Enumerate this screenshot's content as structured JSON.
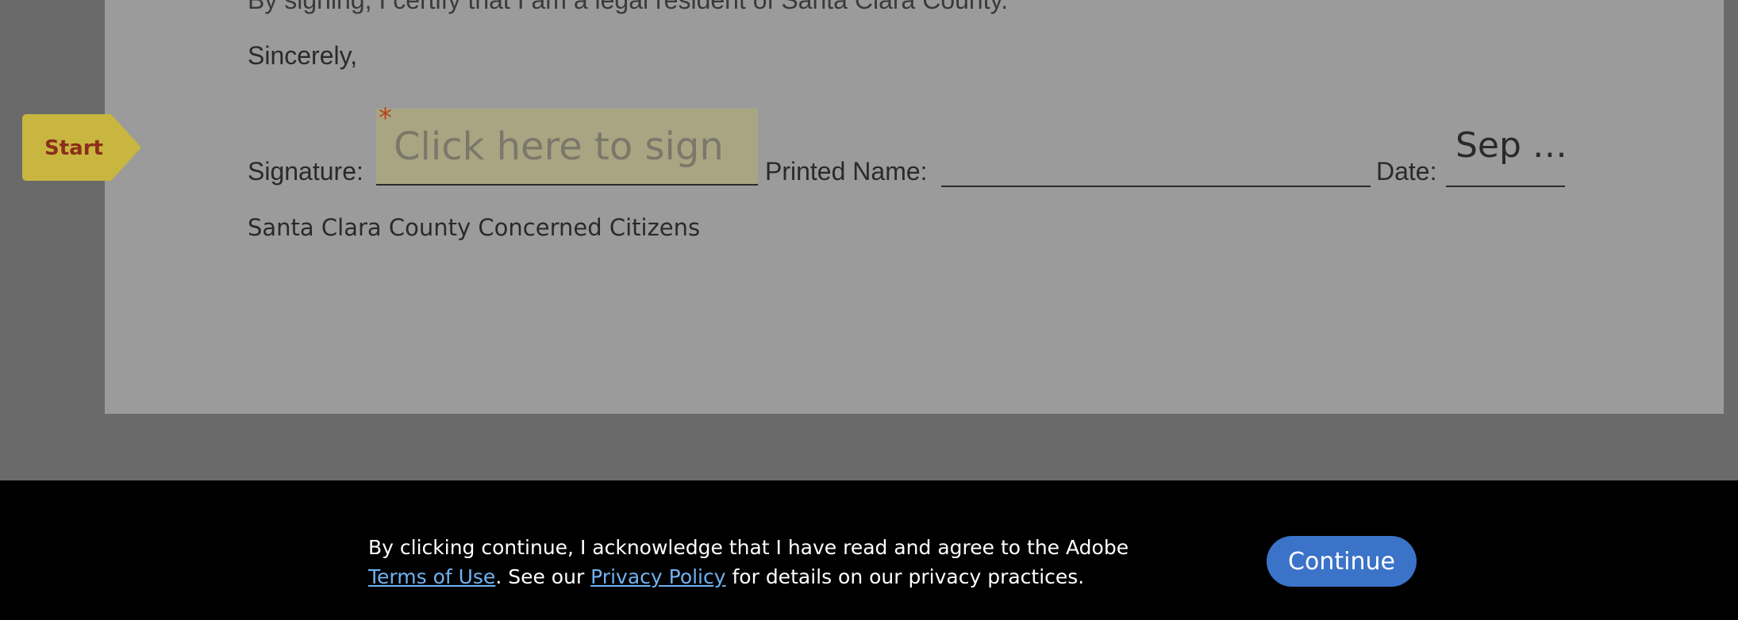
{
  "document": {
    "cut_line": "By signing, I certify that I am a legal resident of Santa Clara County.",
    "closing": "Sincerely,",
    "signature_label": "Signature:",
    "signature_placeholder": "Click here to sign",
    "required_marker": "*",
    "printed_name_label": "Printed Name:",
    "date_label": "Date:",
    "date_value": "Sep …",
    "organization": "Santa Clara County Concerned Citizens"
  },
  "start_tag": {
    "label": "Start"
  },
  "consent": {
    "text_part1": "By clicking continue, I acknowledge that I have read and agree to the Adobe ",
    "terms_link": "Terms of Use",
    "text_part2": ". See our ",
    "privacy_link": "Privacy Policy",
    "text_part3": " for details on our privacy practices.",
    "continue_label": "Continue"
  },
  "colors": {
    "background": "#6a6a6a",
    "page": "#9b9b9b",
    "signature_field": "#a9a583",
    "start_tag": "#c8b640",
    "required": "#b8441e",
    "link": "#6fb2f2",
    "continue_button": "#3b73c9"
  }
}
